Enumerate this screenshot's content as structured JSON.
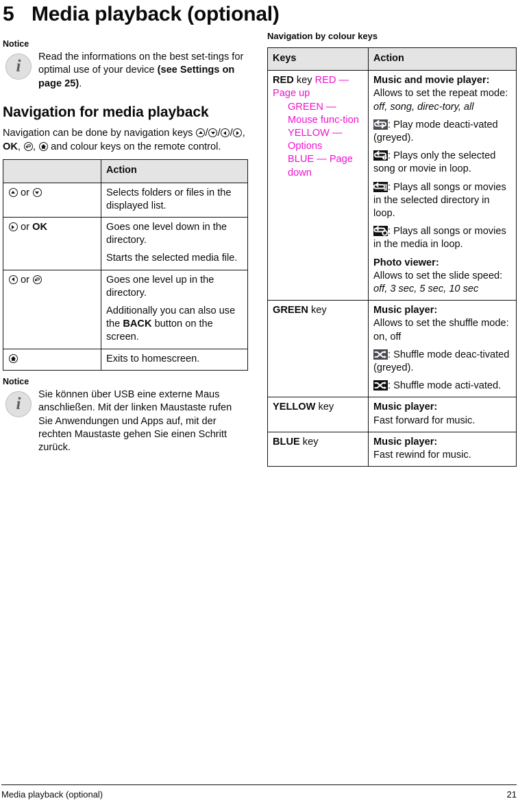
{
  "chapter": {
    "number": "5",
    "title": "Media playback (optional)"
  },
  "notice_label": "Notice",
  "notice_top": {
    "text_1": "Read the informations on the best set-tings for optimal use of your device ",
    "text_bold": "(see Settings on page 25)",
    "text_2": "."
  },
  "section_nav": {
    "heading": "Navigation for media playback"
  },
  "nav_intro": {
    "part_1": "Navigation can be done by navigation keys ",
    "part_2": "/",
    "part_3": "/",
    "part_4": "/",
    "part_5": ", ",
    "ok": "OK",
    "part_6": ", ",
    "part_7": ", ",
    "part_8": " and colour keys on the remote control."
  },
  "nav_table": {
    "headers": [
      "",
      "Action"
    ],
    "rows": [
      {
        "keys_text": " or ",
        "icons": [
          "up-key-icon",
          "down-key-icon"
        ],
        "action": [
          "Selects folders or files in the displayed list."
        ]
      },
      {
        "keys_text": " or ",
        "icons": [
          "right-key-icon"
        ],
        "keys_bold": "OK",
        "action": [
          "Goes one level down in the directory.",
          "Starts the selected media file."
        ]
      },
      {
        "keys_text": " or ",
        "icons": [
          "left-key-icon",
          "back-key-icon"
        ],
        "action": [
          "Goes one level up in the directory.",
          "Additionally you can also use the BACK button on the screen."
        ],
        "action_bold": "BACK"
      },
      {
        "keys_text": "",
        "icons": [
          "home-key-icon"
        ],
        "action": [
          "Exits to homescreen."
        ]
      }
    ]
  },
  "notice_bottom": {
    "text": "Sie können über USB eine externe Maus anschließen. Mit der linken Maustaste rufen Sie Anwendungen und Apps auf, mit der rechten Maustaste gehen Sie einen Schritt zurück."
  },
  "colour_section": {
    "heading": "Navigation by colour keys"
  },
  "colour_table": {
    "headers": [
      "Keys",
      "Action"
    ],
    "rows": [
      {
        "key_bold": "RED",
        "key_rest": " key ",
        "key_magenta_lines": [
          "RED — Page up",
          "GREEN — Mouse func-tion",
          "YELLOW — Options",
          "BLUE — Page down"
        ],
        "action_title": "Music and movie player:",
        "action_line": "Allows to set the repeat mode: ",
        "action_italic": "off, song, direc-tory, all",
        "modes": [
          {
            "icon": "repeat-off-icon",
            "grey": true,
            "text": ": Play mode deacti-vated (greyed)."
          },
          {
            "icon": "repeat-one-icon",
            "grey": false,
            "text": ": Plays only the selected song or movie in loop."
          },
          {
            "icon": "repeat-directory-icon",
            "grey": false,
            "text": ": Plays all songs or movies in the selected directory in loop."
          },
          {
            "icon": "repeat-all-icon",
            "grey": false,
            "text": ": Plays all songs or movies in the media in loop."
          }
        ],
        "photo_title": "Photo viewer:",
        "photo_line": "Allows to set the slide speed: ",
        "photo_italic": "off, 3 sec, 5 sec, 10 sec"
      },
      {
        "key_bold": "GREEN",
        "key_rest": " key",
        "action_title": "Music player:",
        "action_line": "Allows to set the shuffle mode: on, off",
        "modes": [
          {
            "icon": "shuffle-off-icon",
            "grey": true,
            "text": ": Shuffle mode deac-tivated (greyed)."
          },
          {
            "icon": "shuffle-on-icon",
            "grey": false,
            "text": ": Shuffle mode acti-vated."
          }
        ]
      },
      {
        "key_bold": "YELLOW",
        "key_rest": " key",
        "action_title": "Music player:",
        "action_line": "Fast forward for music."
      },
      {
        "key_bold": "BLUE",
        "key_rest": " key",
        "action_title": "Music player:",
        "action_line": "Fast rewind for music."
      }
    ]
  },
  "footer": {
    "left": "Media playback (optional)",
    "right": "21"
  },
  "colors": {
    "accent_magenta": "#f010d0",
    "header_fill": "#e4e4e4",
    "rule": "#111111"
  }
}
